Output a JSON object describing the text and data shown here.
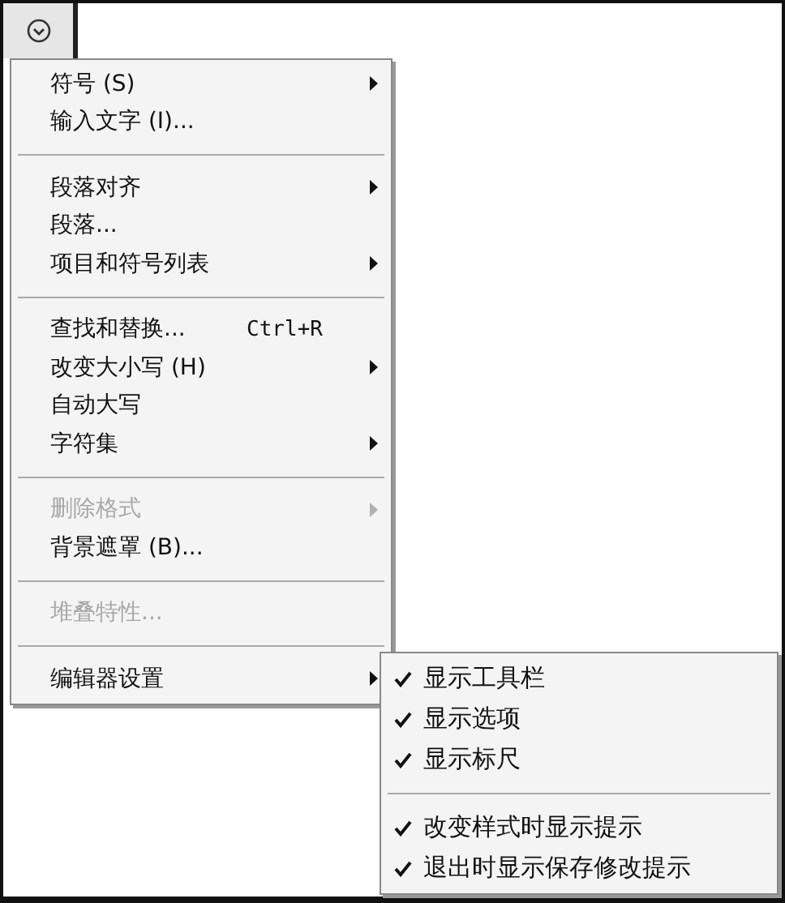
{
  "menu": [
    {
      "kind": "item",
      "label": "符号 (S)",
      "submenu": true,
      "disabled": false
    },
    {
      "kind": "item",
      "label": "输入文字 (I)...",
      "submenu": false,
      "disabled": false
    },
    {
      "kind": "separator"
    },
    {
      "kind": "item",
      "label": "段落对齐",
      "submenu": true,
      "disabled": false
    },
    {
      "kind": "item",
      "label": "段落...",
      "submenu": false,
      "disabled": false
    },
    {
      "kind": "item",
      "label": "项目和符号列表",
      "submenu": true,
      "disabled": false
    },
    {
      "kind": "separator"
    },
    {
      "kind": "item",
      "label": "查找和替换...",
      "shortcut": "Ctrl+R",
      "submenu": false,
      "disabled": false
    },
    {
      "kind": "item",
      "label": "改变大小写 (H)",
      "submenu": true,
      "disabled": false
    },
    {
      "kind": "item",
      "label": "自动大写",
      "submenu": false,
      "disabled": false
    },
    {
      "kind": "item",
      "label": "字符集",
      "submenu": true,
      "disabled": false
    },
    {
      "kind": "separator"
    },
    {
      "kind": "item",
      "label": "删除格式",
      "submenu": true,
      "disabled": true
    },
    {
      "kind": "item",
      "label": "背景遮罩 (B)...",
      "submenu": false,
      "disabled": false
    },
    {
      "kind": "separator"
    },
    {
      "kind": "item",
      "label": "堆叠特性...",
      "submenu": false,
      "disabled": true
    },
    {
      "kind": "separator"
    },
    {
      "kind": "item",
      "label": "编辑器设置",
      "submenu": true,
      "disabled": false
    }
  ],
  "submenu": [
    {
      "kind": "item",
      "label": "显示工具栏",
      "checked": true
    },
    {
      "kind": "item",
      "label": "显示选项",
      "checked": true
    },
    {
      "kind": "item",
      "label": "显示标尺",
      "checked": true
    },
    {
      "kind": "separator"
    },
    {
      "kind": "item",
      "label": "改变样式时显示提示",
      "checked": true
    },
    {
      "kind": "item",
      "label": "退出时显示保存修改提示",
      "checked": true
    }
  ]
}
